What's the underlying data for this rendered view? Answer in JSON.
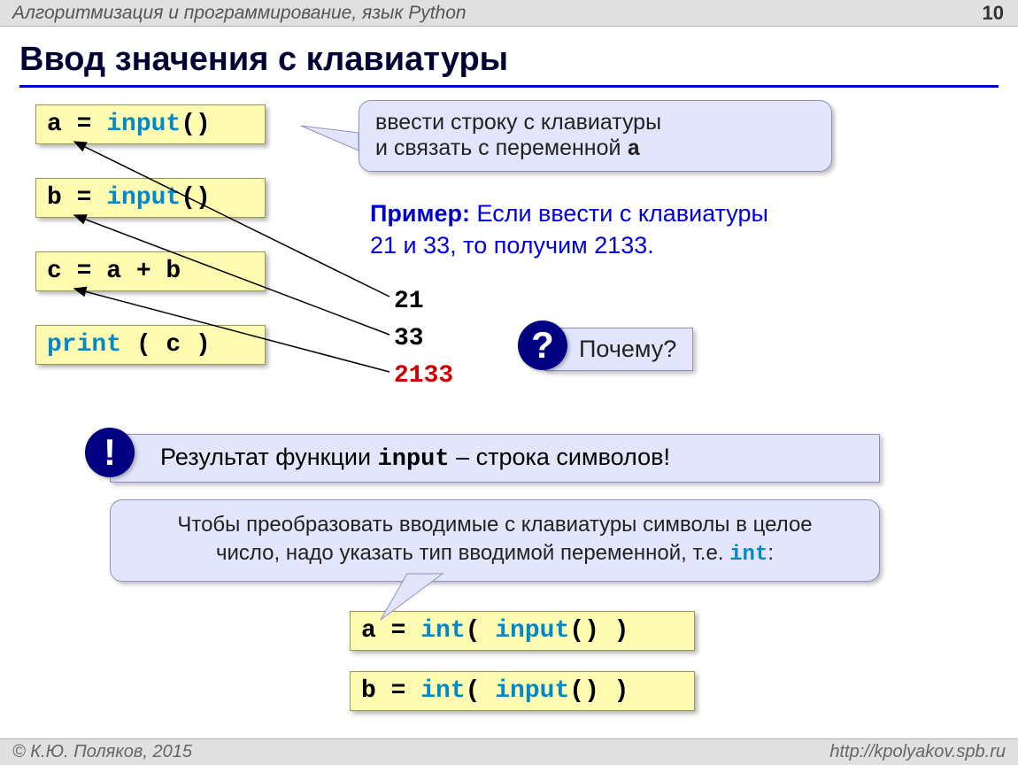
{
  "header": {
    "title": "Алгоритмизация и программирование,  язык Python",
    "page": "10"
  },
  "title": "Ввод значения с клавиатуры",
  "code": {
    "c1_a": "a = ",
    "c1_kw": "input",
    "c1_b": "()",
    "c2_a": "b = ",
    "c2_kw": "input",
    "c2_b": "()",
    "c3": "c = a + b",
    "c4_kw": "print",
    "c4_b": " ( c )",
    "c5_a": "a = ",
    "c5_kw1": "int",
    "c5_b": "( ",
    "c5_kw2": "input",
    "c5_c": "() )",
    "c6_a": "b = ",
    "c6_kw1": "int",
    "c6_b": "( ",
    "c6_kw2": "input",
    "c6_c": "() )"
  },
  "bubble1_a": "ввести строку с клавиатуры",
  "bubble1_b": "и связать с переменной ",
  "bubble1_c": "a",
  "example": {
    "label": "Пример:",
    "text_a": " Если ввести с клавиатуры",
    "text_b": "21 и 33, то получим 2133."
  },
  "output": {
    "l1": "21",
    "l2": "33",
    "l3": "2133"
  },
  "question": "Почему?",
  "info_a": "Результат функции ",
  "info_b": "input",
  "info_c": " – строка символов!",
  "convert_a": "Чтобы преобразовать вводимые с клавиатуры символы в целое",
  "convert_b": "число, надо указать тип вводимой переменной, т.е. ",
  "convert_c": "int",
  "convert_d": ":",
  "footer": {
    "copyright": "© К.Ю. Поляков, 2015",
    "url": "http://kpolyakov.spb.ru"
  }
}
